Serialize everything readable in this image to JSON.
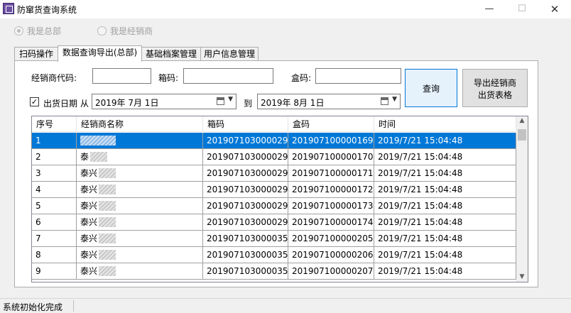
{
  "window": {
    "title": "防窜货查询系统",
    "minimize_glyph": "—",
    "maximize_glyph": "☐",
    "close_glyph": "✕",
    "icon": "app-icon"
  },
  "mode": {
    "headquarters_label": "我是总部",
    "dealer_label": "我是经销商",
    "selected": "headquarters"
  },
  "tabs": [
    "扫码操作",
    "数据查询导出(总部)",
    "基础档案管理",
    "用户信息管理"
  ],
  "active_tab": 1,
  "query": {
    "dealer_code_label": "经销商代码:",
    "dealer_code_value": "",
    "carton_code_label": "箱码:",
    "carton_code_value": "",
    "box_code_label": "盒码:",
    "box_code_value": "",
    "ship_date_label": "出货日期",
    "ship_date_checked": true,
    "check_glyph": "✓",
    "from_label": "从",
    "from_date": "2019年  7月  1日",
    "to_label": "到",
    "to_date": "2019年  8月  1日",
    "query_button": "查询",
    "export_button_line1": "导出经销商",
    "export_button_line2": "出货表格"
  },
  "table": {
    "columns": [
      "序号",
      "经销商名称",
      "箱码",
      "盒码",
      "时间"
    ],
    "rows": [
      [
        "1",
        "",
        "201907103000029",
        "201907100000169",
        "2019/7/21 15:04:48"
      ],
      [
        "2",
        "泰",
        "201907103000029",
        "201907100000170",
        "2019/7/21 15:04:48"
      ],
      [
        "3",
        "泰兴",
        "201907103000029",
        "201907100000171",
        "2019/7/21 15:04:48"
      ],
      [
        "4",
        "泰兴",
        "201907103000029",
        "201907100000172",
        "2019/7/21 15:04:48"
      ],
      [
        "5",
        "泰兴",
        "201907103000029",
        "201907100000173",
        "2019/7/21 15:04:48"
      ],
      [
        "6",
        "泰兴",
        "201907103000029",
        "201907100000174",
        "2019/7/21 15:04:48"
      ],
      [
        "7",
        "泰兴",
        "201907103000035",
        "201907100000205",
        "2019/7/21 15:04:48"
      ],
      [
        "8",
        "泰兴",
        "201907103000035",
        "201907100000206",
        "2019/7/21 15:04:48"
      ],
      [
        "9",
        "泰兴",
        "201907103000035",
        "201907100000207",
        "2019/7/21 15:04:48"
      ]
    ],
    "selected_row": 0
  },
  "scroll": {
    "up_glyph": "▲",
    "down_glyph": "▼"
  },
  "date_arrow_glyph": "▼",
  "status": {
    "text": "系统初始化完成"
  },
  "colors": {
    "selection": "#0078d7",
    "primary_border": "#0078d7"
  }
}
